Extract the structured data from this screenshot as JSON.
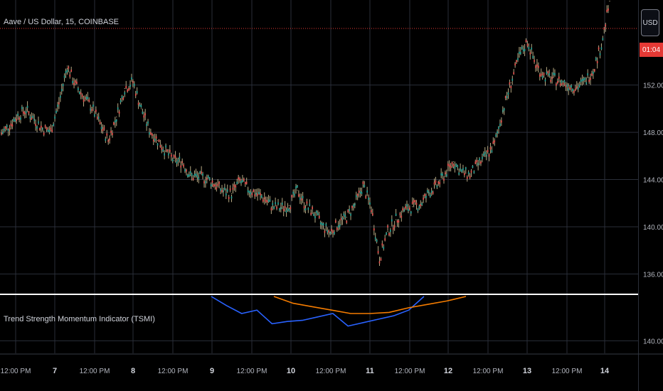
{
  "header": {
    "title": "Aave / US Dollar, 15, COINBASE",
    "currency_button": "USD"
  },
  "indicator": {
    "title": "Trend Strength Momentum Indicator (TSMI)",
    "axis_label": "140.00"
  },
  "price_badge": "01:04",
  "colors": {
    "background": "#000000",
    "grid": "#2a2e39",
    "candle_up": "#26a69a",
    "candle_down": "#ef5350",
    "wick": "#b5a882",
    "last_price_line": "#e53935",
    "tsmi_blue": "#2962ff",
    "tsmi_orange": "#f57c00",
    "separator": "#ffffff"
  },
  "chart_data": [
    {
      "type": "line",
      "title": "Aave / US Dollar, 15, COINBASE",
      "ylabel": "",
      "ylim": [
        134.4,
        159.2
      ],
      "y_ticks": [
        "152.00",
        "148.00",
        "144.00",
        "140.00",
        "136.00"
      ],
      "x_ticks": [
        "12:00 PM",
        "7",
        "12:00 PM",
        "8",
        "12:00 PM",
        "9",
        "12:00 PM",
        "10",
        "12:00 PM",
        "11",
        "12:00 PM",
        "12",
        "12:00 PM",
        "13",
        "12:00 PM",
        "14"
      ],
      "series": [
        {
          "values": [
            147.9,
            148.6,
            149.4,
            149.9,
            149.1,
            148.3,
            148.1,
            150.5,
            153.6,
            152.0,
            151.0,
            150.1,
            148.7,
            147.3,
            149.3,
            151.7,
            152.3,
            150.0,
            148.2,
            147.3,
            146.4,
            145.6,
            145.5,
            144.3,
            144.2,
            144.1,
            143.6,
            143.0,
            142.8,
            143.9,
            143.2,
            142.8,
            142.4,
            141.7,
            141.6,
            141.8,
            143.1,
            141.8,
            141.2,
            140.1,
            139.5,
            140.3,
            140.8,
            141.9,
            143.5,
            141.6,
            137.3,
            139.6,
            140.6,
            141.4,
            141.7,
            141.9,
            142.9,
            143.5,
            144.5,
            145.5,
            144.6,
            144.4,
            145.3,
            146.0,
            147.0,
            149.8,
            152.2,
            154.4,
            155.7,
            153.7,
            152.8,
            152.6,
            152.3,
            152.0,
            151.8,
            152.3,
            153.3,
            155.4,
            159.1
          ]
        }
      ]
    },
    {
      "type": "line",
      "title": "Trend Strength Momentum Indicator (TSMI)",
      "ylim": [
        138.9,
        143.9
      ],
      "y_ticks": [
        "140.00"
      ],
      "series": [
        {
          "name": "",
          "color": "blue",
          "values": [
            143.9,
            143.1,
            142.4,
            142.7,
            141.5,
            141.7,
            141.8,
            142.1,
            142.4,
            141.3,
            141.6,
            141.9,
            142.2,
            142.7,
            143.9
          ]
        },
        {
          "name": "",
          "color": "orange",
          "values": [
            143.9,
            143.3,
            143.0,
            142.7,
            142.4,
            142.4,
            142.5,
            142.9,
            143.2,
            143.5,
            143.9
          ]
        }
      ]
    }
  ]
}
